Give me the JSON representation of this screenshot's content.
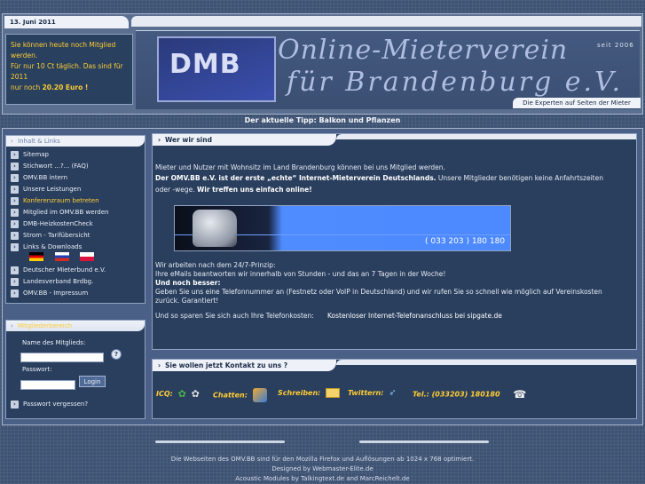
{
  "header": {
    "date": "13. Juni 2011",
    "promo_lines": [
      "Sie können heute noch Mitglied",
      "werden.",
      "Für nur 10 Ct täglich. Das sind für",
      "2011"
    ],
    "promo_last_prefix": "nur noch ",
    "promo_price": "20.20 Euro !",
    "logo_text": "DMB",
    "title_line1": "Online-Mieterverein",
    "title_line2": "für Brandenburg e.V.",
    "since": "seit 2006",
    "experts_tab": "Die Experten auf Seiten der Mieter"
  },
  "tip": "Der aktuelle Tipp: Balkon und Pflanzen",
  "sidebar": {
    "nav_title": "Inhalt & Links",
    "items": [
      {
        "label": "Sitemap",
        "highlight": false
      },
      {
        "label": "Stichwort ...?... (FAQ)",
        "highlight": false
      },
      {
        "label": "OMV.BB intern",
        "highlight": false
      },
      {
        "label": "Unsere Leistungen",
        "highlight": false
      },
      {
        "label": "Konferenzraum betreten",
        "highlight": true
      },
      {
        "label": "Mitglied im OMV.BB werden",
        "highlight": false
      },
      {
        "label": "DMB-HeizkostenCheck",
        "highlight": false
      },
      {
        "label": "Strom - Tarifübersicht",
        "highlight": false
      },
      {
        "label": "Links & Downloads",
        "highlight": false
      },
      {
        "label": "Deutscher Mieterbund e.V.",
        "highlight": false
      },
      {
        "label": "Landesverband Brdbg.",
        "highlight": false
      },
      {
        "label": "OMV.BB - Impressum",
        "highlight": false
      }
    ],
    "flags": [
      "german-flag",
      "russian-flag",
      "polish-flag"
    ],
    "member_title": "Mitgliederbereich",
    "name_label": "Name des Mitglieds:",
    "password_label": "Passwort:",
    "login_button": "Login",
    "forgot_password": "Passwort vergessen?"
  },
  "content": {
    "title": "Wer wir sind",
    "intro": "Mieter und Nutzer mit Wohnsitz im Land Brandenburg können bei uns Mitglied werden.",
    "claim_bold": "Der OMV.BB e.V. ist der erste „echte“ Internet-Mieterverein Deutschlands.",
    "claim_rest": " Unsere Mitglieder benötigen keine Anfahrtszeiten",
    "claim_line2": "oder -wege. ",
    "claim_line2_bold": "Wir treffen uns einfach online!",
    "phone_number": "( 033 203 ) 180 180",
    "principle": "Wir arbeiten nach dem 24/7-Prinzip:",
    "principle_detail": "Ihre eMails beantworten wir innerhalb von Stunden - und das an 7 Tagen in der Woche!",
    "better_bold": "Und noch besser:",
    "better_detail": "Geben Sie uns eine Telefonnummer an (Festnetz oder VoIP in Deutschland) und wir rufen Sie so schnell wie möglich auf Vereinskosten",
    "guarantee": "zurück. Garantiert!",
    "save_text": "Und so sparen Sie sich auch Ihre Telefonkosten:",
    "save_link": "Kostenloser Internet-Telefonanschluss bei sipgate.de"
  },
  "contact": {
    "title": "Sie wollen jetzt Kontakt zu uns ?",
    "icq": "ICQ:",
    "chat": "Chatten:",
    "write": "Schreiben:",
    "twitter": "Twittern:",
    "phone": "Tel.: (033203) 180180"
  },
  "footer": {
    "line1": "Die Webseiten des OMV.BB sind für den Mozilla Firefox und Auflösungen ab 1024 x 768 optimiert.",
    "line2": "Designed by Webmaster-Elite.de",
    "line3": "Acoustic Modules by Talkingtext.de and MarcReichelt.de"
  }
}
